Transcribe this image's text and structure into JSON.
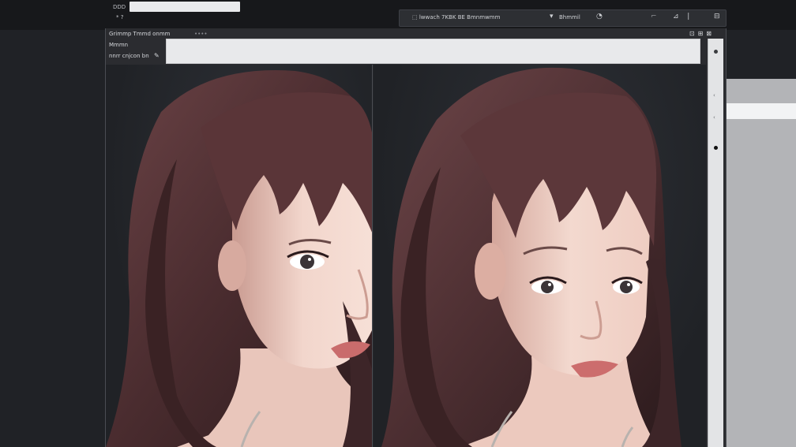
{
  "topbar": {
    "left_label": "DDD",
    "sub_label": "* ?",
    "toolbar": {
      "item1": "⬚ lwwach 7KBK BE Bmnmwmm",
      "item2": "Bhmmil",
      "icon_dropdown": "chevron-down-icon",
      "icon_help": "help-icon"
    }
  },
  "window": {
    "title": "Grimmp Tmmd onmm",
    "title_extra": "••••",
    "label1": "Mmmn",
    "label2": "nnrr cnjcon bn",
    "prompt_input": {
      "value": "",
      "placeholder": ""
    }
  },
  "images": {
    "left": {
      "description_icon": "portrait-image"
    },
    "right": {
      "description_icon": "portrait-image"
    }
  },
  "colors": {
    "background": "#202226",
    "topbar": "#17181b",
    "window": "#2b2c30",
    "input": "#e8e9eb",
    "hair": "#4a2a2c",
    "skin": "#f1d2c7",
    "side_panel": "#b3b4b7"
  }
}
